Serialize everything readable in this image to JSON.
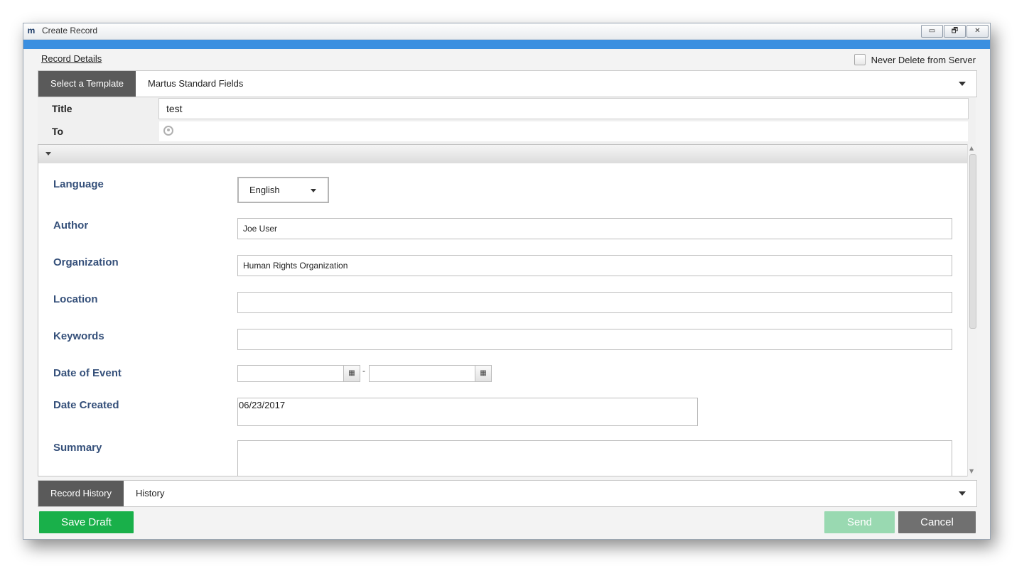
{
  "window": {
    "title": "Create Record",
    "minimize_glyph": "▭",
    "restore_glyph": "🗗",
    "close_glyph": "✕"
  },
  "header": {
    "record_details_label": "Record Details",
    "never_delete_label": "Never Delete from Server"
  },
  "template": {
    "label": "Select a Template",
    "value": "Martus Standard Fields"
  },
  "top_fields": {
    "title_label": "Title",
    "title_value": "test",
    "to_label": "To"
  },
  "form": {
    "language_label": "Language",
    "language_value": "English",
    "author_label": "Author",
    "author_value": "Joe User",
    "organization_label": "Organization",
    "organization_value": "Human Rights Organization",
    "location_label": "Location",
    "location_value": "",
    "keywords_label": "Keywords",
    "keywords_value": "",
    "date_of_event_label": "Date of Event",
    "date_range_separator": "-",
    "date_created_label": "Date Created",
    "date_created_value": "06/23/2017",
    "summary_label": "Summary"
  },
  "history": {
    "label": "Record History",
    "value": "History"
  },
  "buttons": {
    "save_draft": "Save Draft",
    "send": "Send",
    "cancel": "Cancel"
  },
  "colors": {
    "accent": "#3b8fe0",
    "save_draft": "#19b04a",
    "send_disabled": "#99d9b1",
    "cancel": "#707070",
    "form_label": "#35507a",
    "dark_tab": "#5a5a5a"
  }
}
